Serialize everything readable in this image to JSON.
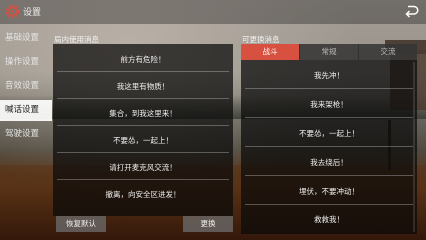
{
  "app": {
    "title": "设置"
  },
  "nav": {
    "items": [
      {
        "label": "基础设置",
        "active": false
      },
      {
        "label": "操作设置",
        "active": false
      },
      {
        "label": "音效设置",
        "active": false
      },
      {
        "label": "喊话设置",
        "active": true
      },
      {
        "label": "驾驶设置",
        "active": false
      }
    ]
  },
  "left_panel": {
    "header": "局内使用消息",
    "messages": [
      "前方有危险！",
      "我这里有物质！",
      "集合，到我这里来！",
      "不要怂，一起上！",
      "请打开麦克风交流！",
      "撤离，向安全区进发！"
    ]
  },
  "right_panel": {
    "header": "可更换消息",
    "tabs": [
      {
        "label": "战斗",
        "active": true
      },
      {
        "label": "常规",
        "active": false
      },
      {
        "label": "交流",
        "active": false
      }
    ],
    "messages": [
      "我先冲！",
      "我来架枪！",
      "不要怂，一起上！",
      "我去绕后！",
      "埋伏，不要冲动！",
      "救救我！"
    ]
  },
  "buttons": {
    "restore_default": "恢复默认",
    "swap": "更换"
  },
  "icons": {
    "settings": "gear-icon",
    "back": "return-icon"
  },
  "colors": {
    "accent": "#d8503f",
    "active_nav": "#ffffff"
  }
}
